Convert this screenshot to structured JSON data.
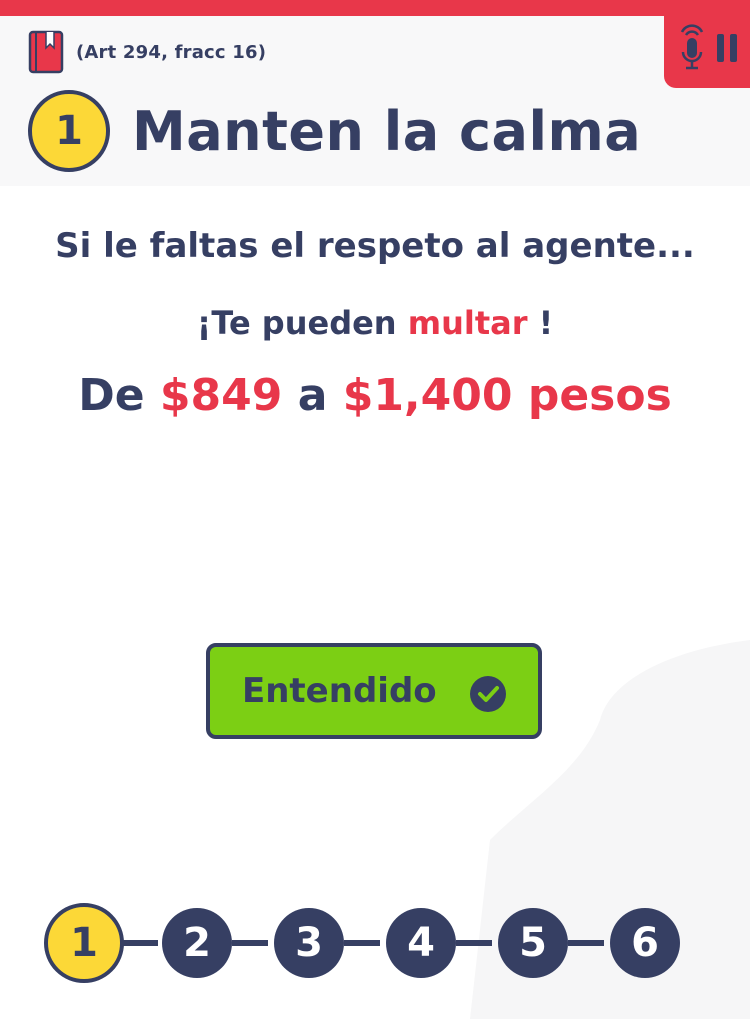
{
  "header": {
    "article_ref": "(Art 294, fracc 16)",
    "step_number": "1",
    "title": "Manten la calma"
  },
  "message": {
    "line1": "Si le faltas el respeto al agente...",
    "line2_prefix": "¡Te pueden ",
    "line2_highlight": "multar",
    "line2_suffix": " !",
    "line3_prefix": "De ",
    "amount_min": "$849",
    "line3_mid": " a ",
    "amount_max": "$1,400",
    "currency": " pesos"
  },
  "confirm_button": {
    "label": "Entendido"
  },
  "stepper": {
    "current": 1,
    "steps": [
      "1",
      "2",
      "3",
      "4",
      "5",
      "6"
    ]
  },
  "colors": {
    "accent_red": "#e8374a",
    "navy": "#363f63",
    "yellow": "#fcd837",
    "green": "#7ccf14"
  },
  "icons": [
    "book-icon",
    "microphone-icon",
    "pause-icon",
    "check-circle-icon"
  ]
}
